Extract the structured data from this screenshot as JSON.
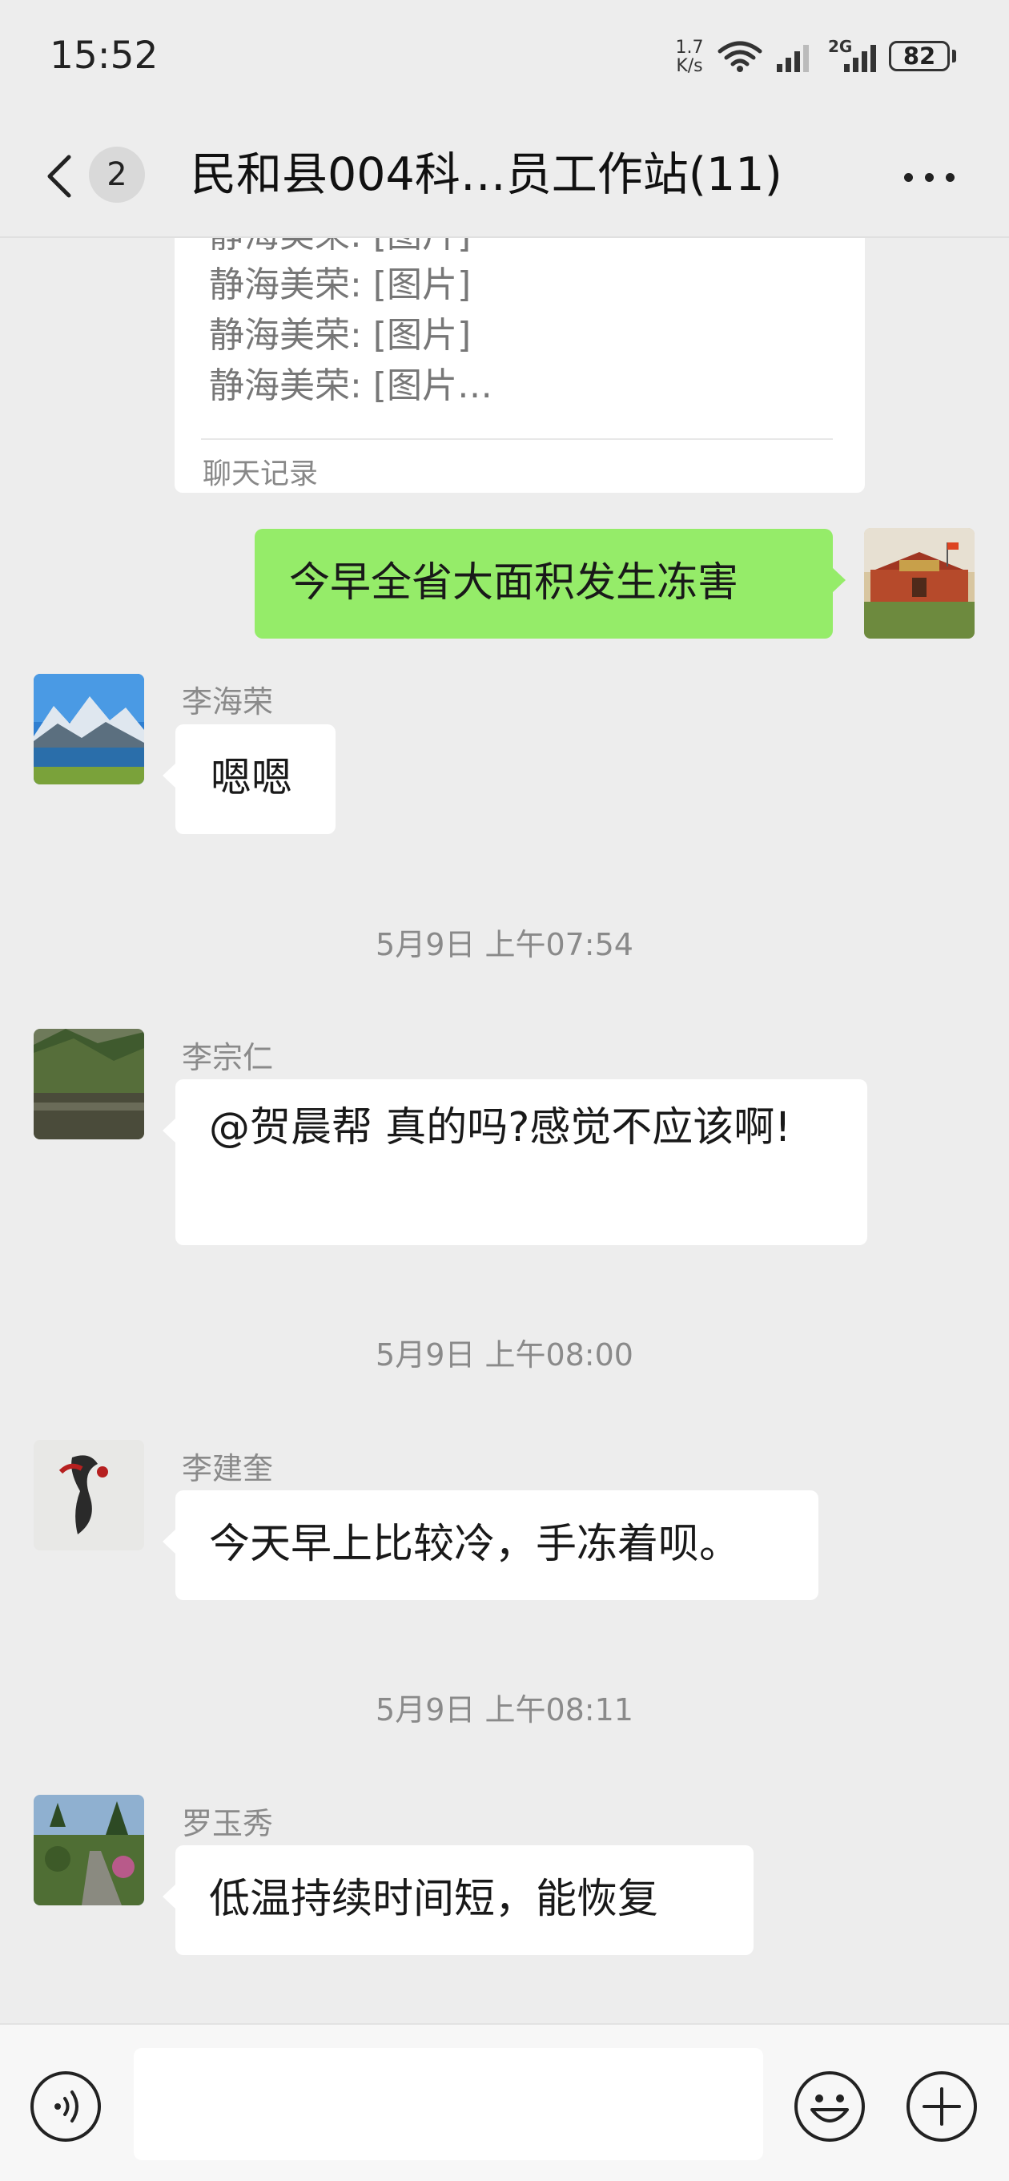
{
  "status_bar": {
    "time": "15:52",
    "net_speed_value": "1.7",
    "net_speed_unit": "K/s",
    "network_tag": "2G",
    "battery": "82"
  },
  "header": {
    "unread_count": "2",
    "title": "民和县004科…员工作站(11)"
  },
  "chat_record_card": {
    "lines": [
      "静海美荣: [图片]",
      "静海美荣: [图片]",
      "静海美荣: [图片]",
      "静海美荣: [图片…"
    ],
    "label": "聊天记录"
  },
  "messages": [
    {
      "type": "outgoing",
      "text": "今早全省大面积发生冻害"
    },
    {
      "type": "incoming",
      "sender": "李海荣",
      "text": "嗯嗯"
    },
    {
      "type": "time",
      "text": "5月9日 上午07:54"
    },
    {
      "type": "incoming",
      "sender": "李宗仁",
      "text": "@贺晨帮  真的吗?感觉不应该啊!"
    },
    {
      "type": "time",
      "text": "5月9日 上午08:00"
    },
    {
      "type": "incoming",
      "sender": "李建奎",
      "text": "今天早上比较冷，手冻着呗。"
    },
    {
      "type": "time",
      "text": "5月9日 上午08:11"
    },
    {
      "type": "incoming",
      "sender": "罗玉秀",
      "text": "低温持续时间短，能恢复"
    }
  ],
  "input": {
    "value": ""
  },
  "colors": {
    "background": "#ededed",
    "outgoing_bubble": "#95ec69",
    "incoming_bubble": "#ffffff",
    "bottom_bar": "#f7f7f7"
  },
  "icons": [
    "back-icon",
    "more-icon",
    "voice-icon",
    "emoji-icon",
    "plus-icon",
    "wifi-icon",
    "signal-icon",
    "battery-icon"
  ]
}
